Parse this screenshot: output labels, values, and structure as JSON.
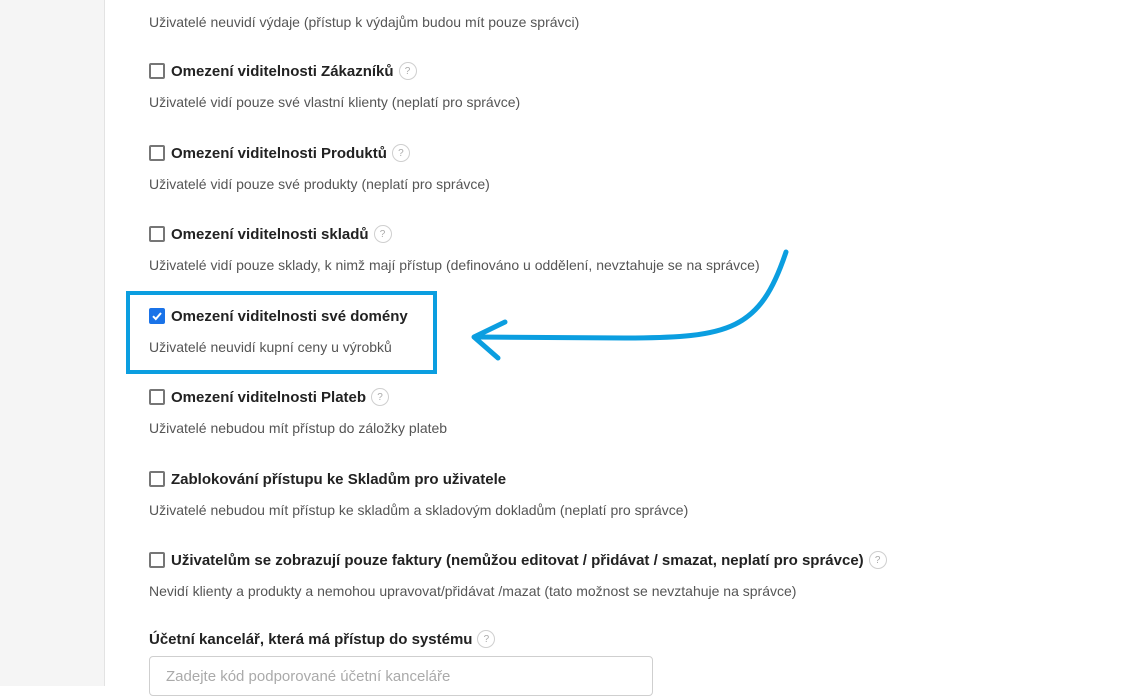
{
  "intro_text": "Uživatelé neuvidí výdaje (přístup k výdajům budou mít pouze správci)",
  "options": [
    {
      "label": "Omezení viditelnosti Zákazníků",
      "description": "Uživatelé vidí pouze své vlastní klienty (neplatí pro správce)",
      "checked": false,
      "help": "?"
    },
    {
      "label": "Omezení viditelnosti Produktů",
      "description": "Uživatelé vidí pouze své produkty (neplatí pro správce)",
      "checked": false,
      "help": "?"
    },
    {
      "label": "Omezení viditelnosti skladů",
      "description": "Uživatelé vidí pouze sklady, k nimž mají přístup (definováno u oddělení, nevztahuje se na správce)",
      "checked": false,
      "help": "?"
    },
    {
      "label": "Omezení viditelnosti své domény",
      "description": "Uživatelé neuvidí kupní ceny u výrobků",
      "checked": true
    },
    {
      "label": "Omezení viditelnosti Plateb",
      "description": "Uživatelé nebudou mít přístup do záložky plateb",
      "checked": false,
      "help": "?"
    },
    {
      "label": "Zablokování přístupu ke Skladům pro uživatele",
      "description": "Uživatelé nebudou mít přístup ke skladům a skladovým dokladům (neplatí pro správce)",
      "checked": false
    },
    {
      "label": "Uživatelům se zobrazují pouze faktury (nemůžou editovat / přidávat / smazat, neplatí pro správce)",
      "description": "Nevidí klienty a produkty a nemohou upravovat/přidávat /mazat (tato možnost se nevztahuje na správce)",
      "checked": false,
      "help": "?"
    }
  ],
  "accounting": {
    "label": "Účetní kancelář, která má přístup do systému",
    "help": "?",
    "placeholder": "Zadejte kód podporované účetní kanceláře"
  },
  "colors": {
    "checkbox_checked": "#1a73e8",
    "annotation": "#0b9ee0"
  }
}
